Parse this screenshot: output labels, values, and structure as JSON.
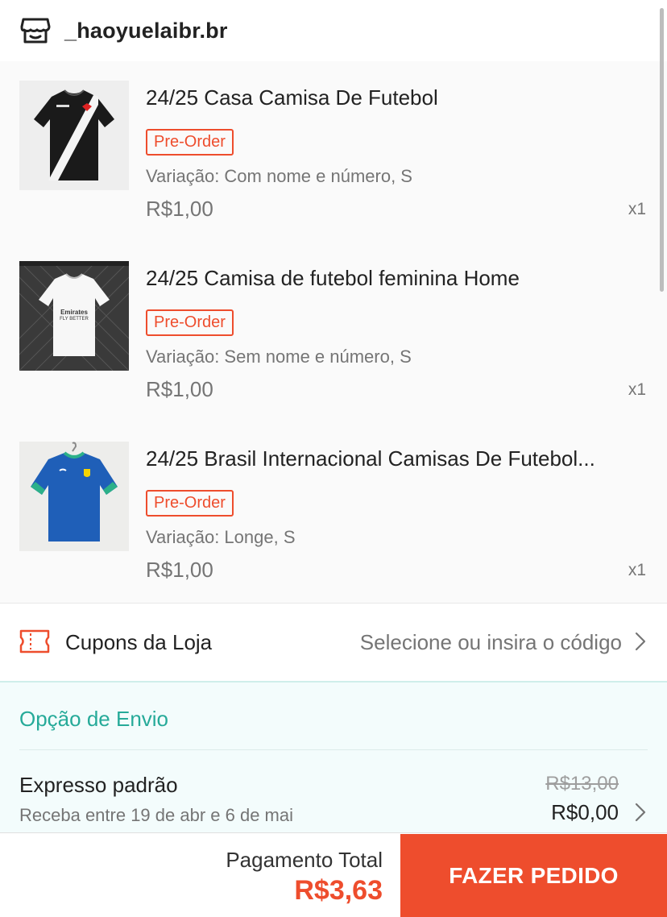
{
  "shop": {
    "name": "_haoyuelaibr.br",
    "icon": "store-icon"
  },
  "items": [
    {
      "title": "24/25 Casa Camisa De Futebol",
      "badge": "Pre-Order",
      "variation": "Variação: Com nome e número, S",
      "price": "R$1,00",
      "qty": "x1",
      "image": "black-white-jersey"
    },
    {
      "title": "24/25 Camisa de futebol feminina Home",
      "badge": "Pre-Order",
      "variation": "Variação: Sem nome e número, S",
      "price": "R$1,00",
      "qty": "x1",
      "image": "white-jersey",
      "image_text": [
        "Emirates",
        "FLY BETTER"
      ]
    },
    {
      "title": "24/25 Brasil Internacional Camisas De Futebol...",
      "badge": "Pre-Order",
      "variation": "Variação: Longe, S",
      "price": "R$1,00",
      "qty": "x1",
      "image": "blue-jersey"
    }
  ],
  "coupons": {
    "label": "Cupons da Loja",
    "action": "Selecione ou insira o código",
    "icon": "ticket-icon"
  },
  "shipping": {
    "heading": "Opção de Envio",
    "method": "Expresso padrão",
    "eta": "Receba entre 19 de abr e 6 de mai",
    "old_price": "R$13,00",
    "new_price": "R$0,00"
  },
  "footer": {
    "total_label": "Pagamento Total",
    "total_value": "R$3,63",
    "order_button": "FAZER PEDIDO"
  },
  "colors": {
    "accent": "#ee4d2d",
    "teal": "#26aa99",
    "muted": "#757575"
  }
}
